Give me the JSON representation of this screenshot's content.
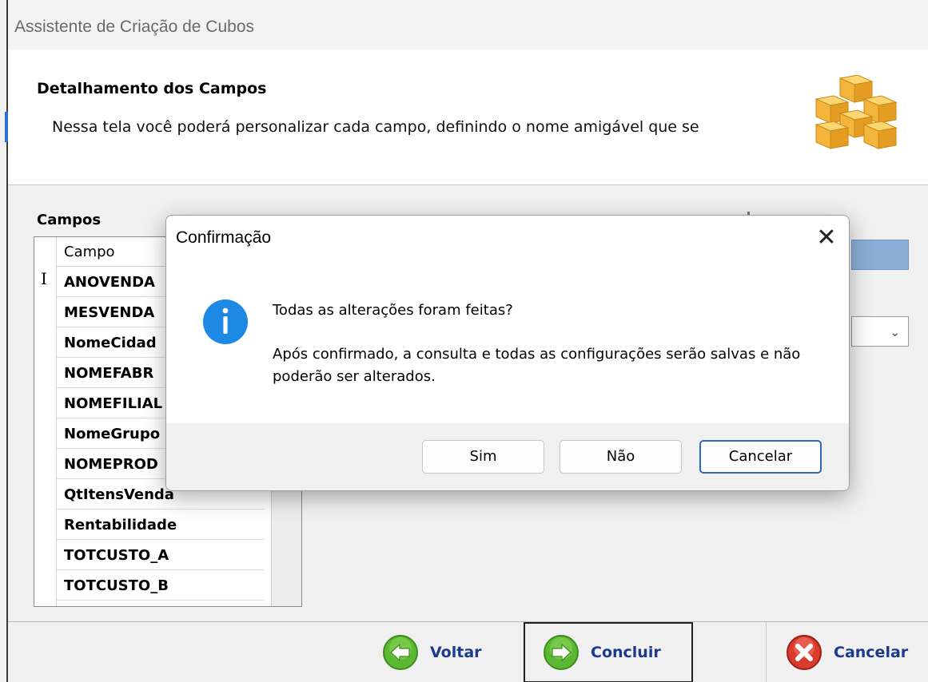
{
  "window": {
    "title": "Assistente de Criação de Cubos"
  },
  "header": {
    "title": "Detalhamento dos Campos",
    "description": "Nessa tela você poderá personalizar cada campo, definindo o nome amigável que se"
  },
  "fields_panel": {
    "label": "Campos",
    "column_header": "Campo",
    "rows": [
      "ANOVENDA",
      "MESVENDA",
      "NomeCidad",
      "NOMEFABR",
      "NOMEFILIAL",
      "NomeGrupo",
      "NOMEPROD",
      "QtItensVenda",
      "Rentabilidade",
      "TOTCUSTO_A",
      "TOTCUSTO_B"
    ],
    "selected_row_marker": "I"
  },
  "footer": {
    "back_label": "Voltar",
    "finish_label": "Concluir",
    "cancel_label": "Cancelar"
  },
  "dialog": {
    "title": "Confirmação",
    "close_glyph": "✕",
    "question": "Todas as alterações foram feitas?",
    "detail": "Após confirmado, a consulta e todas as configurações serão salvas e não poderão ser alterados.",
    "buttons": {
      "yes": "Sim",
      "no": "Não",
      "cancel": "Cancelar"
    },
    "icon": "info-icon"
  },
  "colors": {
    "info_blue": "#1e88e5",
    "nav_green": "#5bb832",
    "cancel_red": "#d93b2e",
    "cube_orange": "#f3b53c",
    "focus_blue": "#2a68c4"
  }
}
